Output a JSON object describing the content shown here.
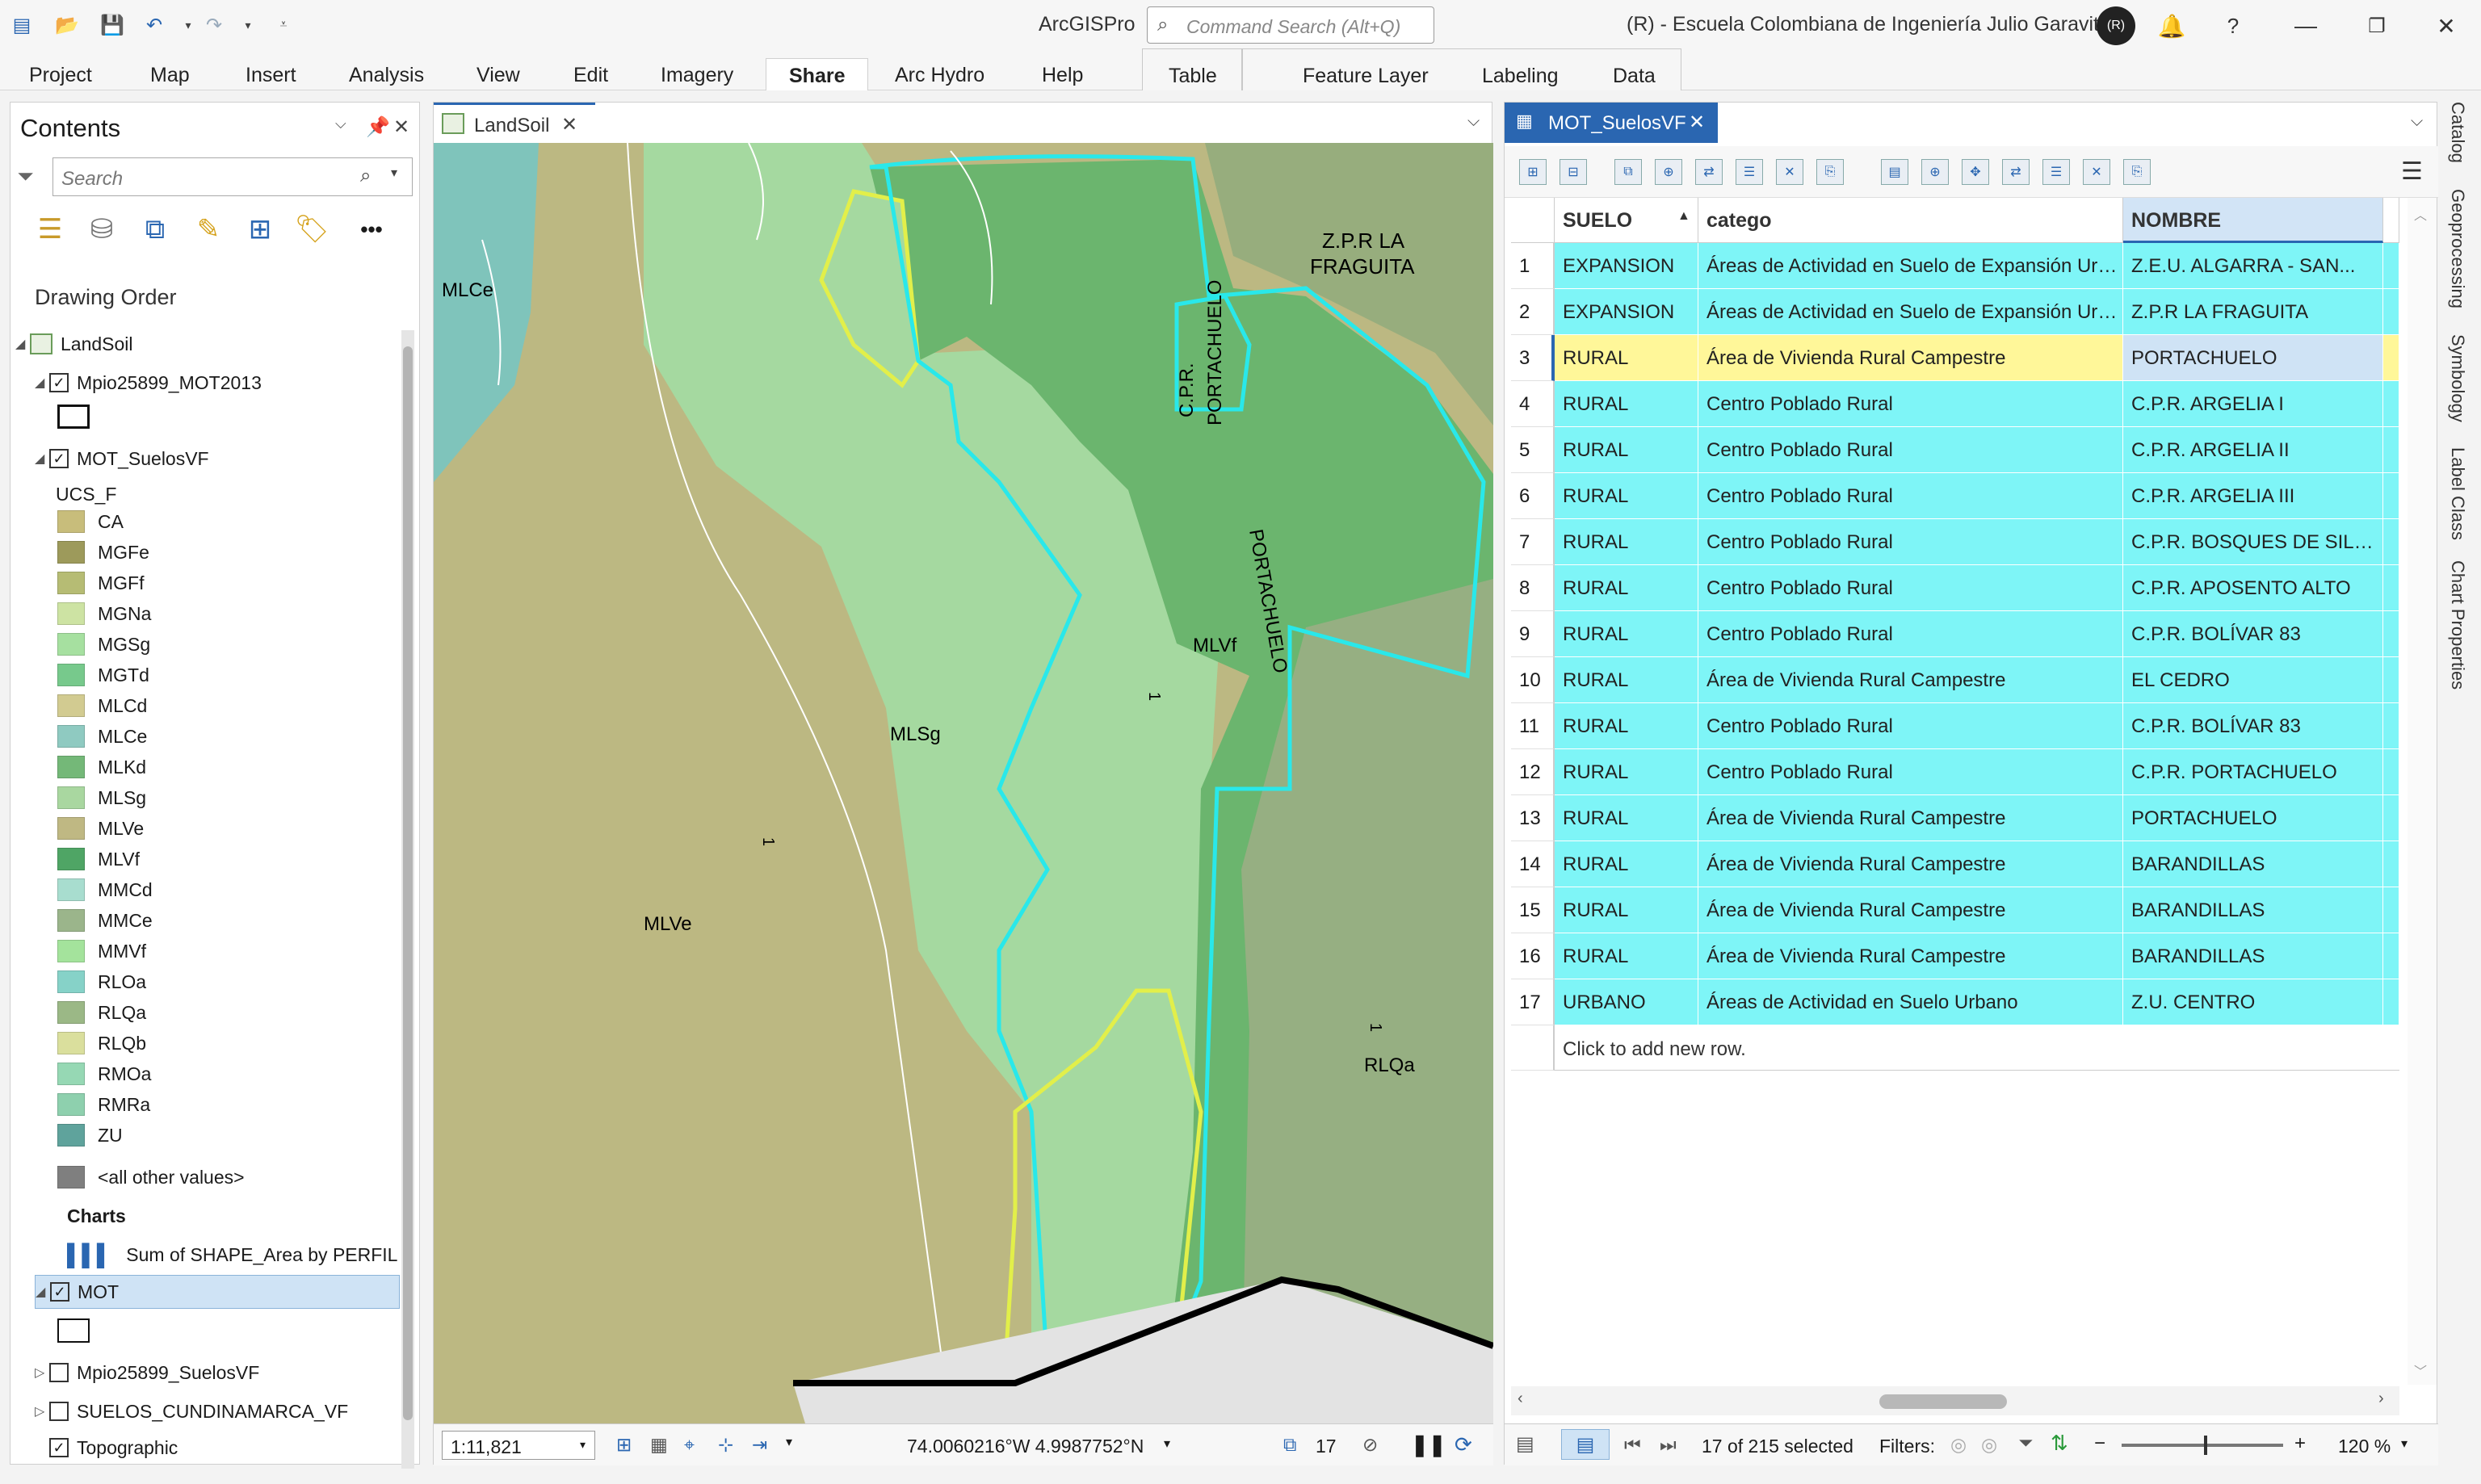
{
  "window": {
    "app_title": "ArcGISPro",
    "command_search_placeholder": "Command Search (Alt+Q)",
    "account": "(R)  -  Escuela Colombiana de Ingeniería Julio Garavito",
    "avatar_initials": "(R)"
  },
  "ribbon": {
    "tabs": [
      "Project",
      "Map",
      "Insert",
      "Analysis",
      "View",
      "Edit",
      "Imagery",
      "Share",
      "Arc Hydro",
      "Help"
    ],
    "active_tab": "Share",
    "context_tabs": [
      "Table",
      "Feature Layer",
      "Labeling",
      "Data"
    ]
  },
  "contents": {
    "title": "Contents",
    "search_placeholder": "Search",
    "drawing_order": "Drawing Order",
    "map_name": "LandSoil",
    "layers": {
      "mot2013": "Mpio25899_MOT2013",
      "suelos_vf": "MOT_SuelosVF",
      "field": "UCS_F",
      "other_values": "<all other values>",
      "charts_heading": "Charts",
      "chart_item": "Sum of SHAPE_Area by PERFIL",
      "mot": "MOT",
      "mpio_suelos": "Mpio25899_SuelosVF",
      "suelos_cund": "SUELOS_CUNDINAMARCA_VF",
      "topographic": "Topographic"
    },
    "legend": [
      {
        "label": "CA",
        "color": "#c8bd7b"
      },
      {
        "label": "MGFe",
        "color": "#9d9a5b"
      },
      {
        "label": "MGFf",
        "color": "#b6bc74"
      },
      {
        "label": "MGNa",
        "color": "#cde3a3"
      },
      {
        "label": "MGSg",
        "color": "#a6e0a0"
      },
      {
        "label": "MGTd",
        "color": "#77c98c"
      },
      {
        "label": "MLCd",
        "color": "#d2cb91"
      },
      {
        "label": "MLCe",
        "color": "#8fcac1"
      },
      {
        "label": "MLKd",
        "color": "#74b878"
      },
      {
        "label": "MLSg",
        "color": "#a9d7a0"
      },
      {
        "label": "MLVe",
        "color": "#bfb883"
      },
      {
        "label": "MLVf",
        "color": "#4fa565"
      },
      {
        "label": "MMCd",
        "color": "#a8ddcf"
      },
      {
        "label": "MMCe",
        "color": "#9bb58b"
      },
      {
        "label": "MMVf",
        "color": "#a4e39c"
      },
      {
        "label": "RLOa",
        "color": "#86d2c8"
      },
      {
        "label": "RLQa",
        "color": "#9bb886"
      },
      {
        "label": "RLQb",
        "color": "#dadf9d"
      },
      {
        "label": "RMOa",
        "color": "#96d8b4"
      },
      {
        "label": "RMRa",
        "color": "#8ed0ae"
      },
      {
        "label": "ZU",
        "color": "#5fa39c"
      }
    ]
  },
  "map": {
    "tab_label": "LandSoil",
    "labels": {
      "mlce": "MLCe",
      "zpr_line1": "Z.P.R LA",
      "zpr_line2": "FRAGUITA",
      "cpr": "C.P.R.",
      "portachuelo_a": "PORTACHUELO",
      "portachuelo_b": "PORTACHUELO",
      "mlvf": "MLVf",
      "mlsg": "MLSg",
      "mlve": "MLVe",
      "rlqa": "RLQa",
      "one_a": "1",
      "one_b": "1",
      "one_c": "1"
    },
    "scale": "1:11,821",
    "coordinates": "74.0060216°W 4.9987752°N",
    "selected_count": "17"
  },
  "table": {
    "tab_label": "MOT_SuelosVF",
    "columns": [
      "SUELO",
      "catego",
      "NOMBRE"
    ],
    "rows": [
      {
        "n": "1",
        "suelo": "EXPANSION",
        "catego": "Áreas de Actividad en Suelo de Expansión Urbana",
        "nombre": "Z.E.U. ALGARRA - SAN..."
      },
      {
        "n": "2",
        "suelo": "EXPANSION",
        "catego": "Áreas de Actividad en Suelo de Expansión Urbana",
        "nombre": "Z.P.R LA FRAGUITA"
      },
      {
        "n": "3",
        "suelo": "RURAL",
        "catego": "Área de Vivienda Rural Campestre",
        "nombre": "PORTACHUELO"
      },
      {
        "n": "4",
        "suelo": "RURAL",
        "catego": "Centro Poblado Rural",
        "nombre": "C.P.R. ARGELIA I"
      },
      {
        "n": "5",
        "suelo": "RURAL",
        "catego": "Centro Poblado Rural",
        "nombre": "C.P.R. ARGELIA II"
      },
      {
        "n": "6",
        "suelo": "RURAL",
        "catego": "Centro Poblado Rural",
        "nombre": "C.P.R. ARGELIA III"
      },
      {
        "n": "7",
        "suelo": "RURAL",
        "catego": "Centro Poblado Rural",
        "nombre": "C.P.R. BOSQUES DE SILE..."
      },
      {
        "n": "8",
        "suelo": "RURAL",
        "catego": "Centro Poblado Rural",
        "nombre": "C.P.R. APOSENTO ALTO"
      },
      {
        "n": "9",
        "suelo": "RURAL",
        "catego": "Centro Poblado Rural",
        "nombre": "C.P.R. BOLÍVAR 83"
      },
      {
        "n": "10",
        "suelo": "RURAL",
        "catego": "Área de Vivienda Rural Campestre",
        "nombre": "EL CEDRO"
      },
      {
        "n": "11",
        "suelo": "RURAL",
        "catego": "Centro Poblado Rural",
        "nombre": "C.P.R. BOLÍVAR 83"
      },
      {
        "n": "12",
        "suelo": "RURAL",
        "catego": "Centro Poblado Rural",
        "nombre": "C.P.R. PORTACHUELO"
      },
      {
        "n": "13",
        "suelo": "RURAL",
        "catego": "Área de Vivienda Rural Campestre",
        "nombre": "PORTACHUELO"
      },
      {
        "n": "14",
        "suelo": "RURAL",
        "catego": "Área de Vivienda Rural Campestre",
        "nombre": "BARANDILLAS"
      },
      {
        "n": "15",
        "suelo": "RURAL",
        "catego": "Área de Vivienda Rural Campestre",
        "nombre": "BARANDILLAS"
      },
      {
        "n": "16",
        "suelo": "RURAL",
        "catego": "Área de Vivienda Rural Campestre",
        "nombre": "BARANDILLAS"
      },
      {
        "n": "17",
        "suelo": "URBANO",
        "catego": "Áreas de Actividad en Suelo Urbano",
        "nombre": "Z.U. CENTRO"
      }
    ],
    "add_row": "Click to add new row.",
    "selection_status": "17 of 215 selected",
    "filters_label": "Filters:",
    "zoom": "120 %",
    "selected_row_color": "#fff799",
    "selection_color": "#7ef5f7"
  },
  "side_tabs": [
    "Catalog",
    "Geoprocessing",
    "Symbology",
    "Label Class",
    "Chart Properties"
  ]
}
